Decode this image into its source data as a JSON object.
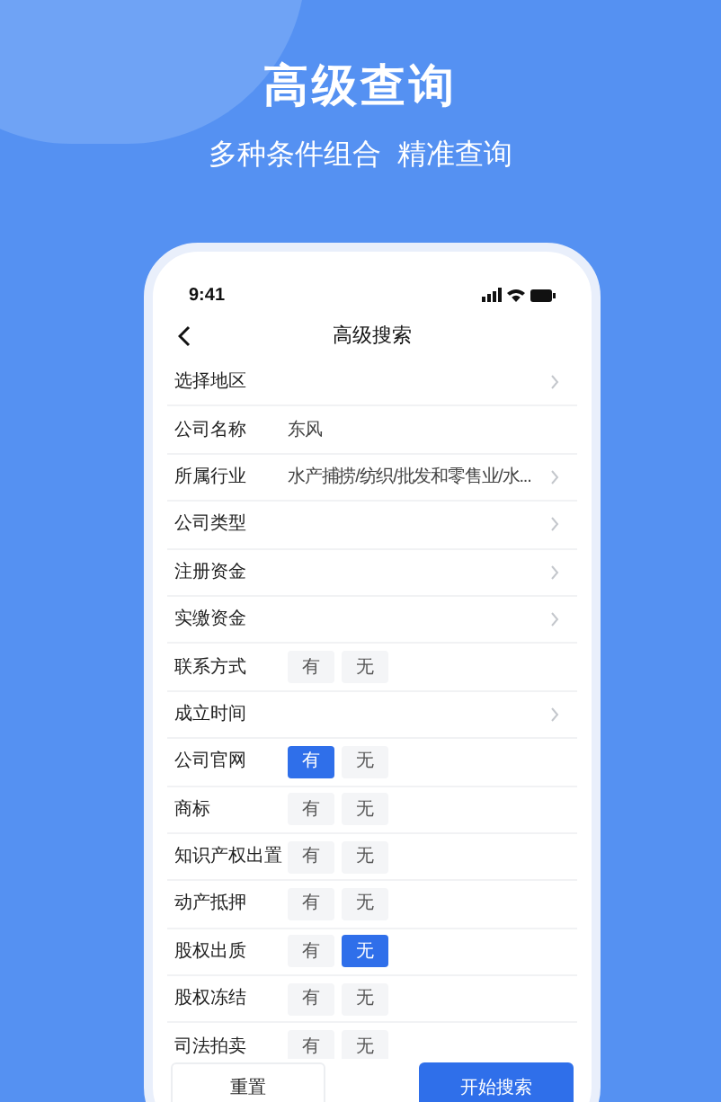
{
  "banner": {
    "title": "高级查询",
    "subtitle": "多种条件组合  精准查询"
  },
  "phone": {
    "status_bar": {
      "time": "9:41"
    },
    "nav": {
      "title": "高级搜索"
    },
    "rows": [
      {
        "kind": "arrow",
        "label": "选择地区"
      },
      {
        "kind": "text",
        "label": "公司名称",
        "value": "东风"
      },
      {
        "kind": "arrow",
        "label": "所属行业",
        "value": "水产捕捞/纺织/批发和零售业/水..."
      },
      {
        "kind": "arrow",
        "label": "公司类型"
      },
      {
        "kind": "arrow",
        "label": "注册资金"
      },
      {
        "kind": "arrow",
        "label": "实缴资金"
      },
      {
        "kind": "toggle",
        "label": "联系方式",
        "options": [
          {
            "label": "有",
            "selected": false
          },
          {
            "label": "无",
            "selected": false
          }
        ]
      },
      {
        "kind": "arrow",
        "label": "成立时间"
      },
      {
        "kind": "toggle",
        "label": "公司官网",
        "options": [
          {
            "label": "有",
            "selected": true
          },
          {
            "label": "无",
            "selected": false
          }
        ]
      },
      {
        "kind": "toggle",
        "label": "商标",
        "options": [
          {
            "label": "有",
            "selected": false
          },
          {
            "label": "无",
            "selected": false
          }
        ]
      },
      {
        "kind": "toggle",
        "label": "知识产权出置",
        "options": [
          {
            "label": "有",
            "selected": false
          },
          {
            "label": "无",
            "selected": false
          }
        ]
      },
      {
        "kind": "toggle",
        "label": "动产抵押",
        "options": [
          {
            "label": "有",
            "selected": false
          },
          {
            "label": "无",
            "selected": false
          }
        ]
      },
      {
        "kind": "toggle",
        "label": "股权出质",
        "options": [
          {
            "label": "有",
            "selected": false
          },
          {
            "label": "无",
            "selected": true
          }
        ]
      },
      {
        "kind": "toggle",
        "label": "股权冻结",
        "options": [
          {
            "label": "有",
            "selected": false
          },
          {
            "label": "无",
            "selected": false
          }
        ]
      },
      {
        "kind": "toggle",
        "label": "司法拍卖",
        "options": [
          {
            "label": "有",
            "selected": false
          },
          {
            "label": "无",
            "selected": false
          }
        ]
      }
    ],
    "buttons": [
      {
        "kind": "secondary",
        "label": "重置"
      },
      {
        "kind": "primary",
        "label": "开始搜索"
      }
    ]
  }
}
